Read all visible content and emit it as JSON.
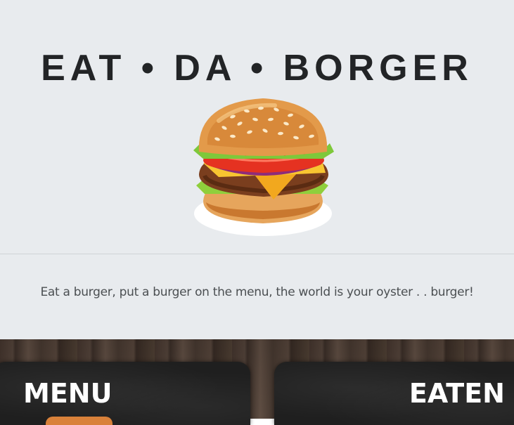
{
  "header": {
    "title": "EAT • DA • BORGER",
    "logo_icon": "burger-icon",
    "tagline": "Eat a burger, put a burger on the menu, the world is your oyster . . burger!"
  },
  "boards": {
    "menu": {
      "title": "MENU"
    },
    "eaten": {
      "title": "EATEN"
    }
  },
  "colors": {
    "hero_background": "#e8ebee",
    "title": "#222426",
    "board": "#1f1f1f",
    "board_text": "#ffffff"
  }
}
